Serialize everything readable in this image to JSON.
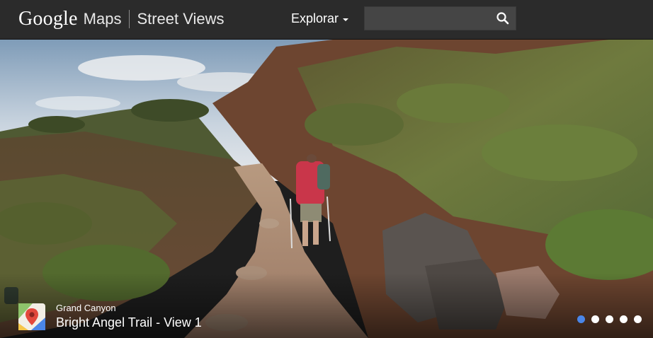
{
  "header": {
    "logo_google": "Google",
    "logo_maps": "Maps",
    "product": "Street Views",
    "explore_label": "Explorar",
    "search": {
      "value": "",
      "placeholder": ""
    }
  },
  "scene": {
    "location": "Grand Canyon",
    "title": "Bright Angel Trail - View 1"
  },
  "carousel": {
    "count": 5,
    "active_index": 0
  },
  "colors": {
    "header_bg": "#2b2b2b",
    "search_bg": "#454545",
    "active_dot": "#4a86e8",
    "dot": "#ffffff"
  },
  "icons": {
    "search": "search-icon",
    "pin": "maps-pin-icon"
  }
}
